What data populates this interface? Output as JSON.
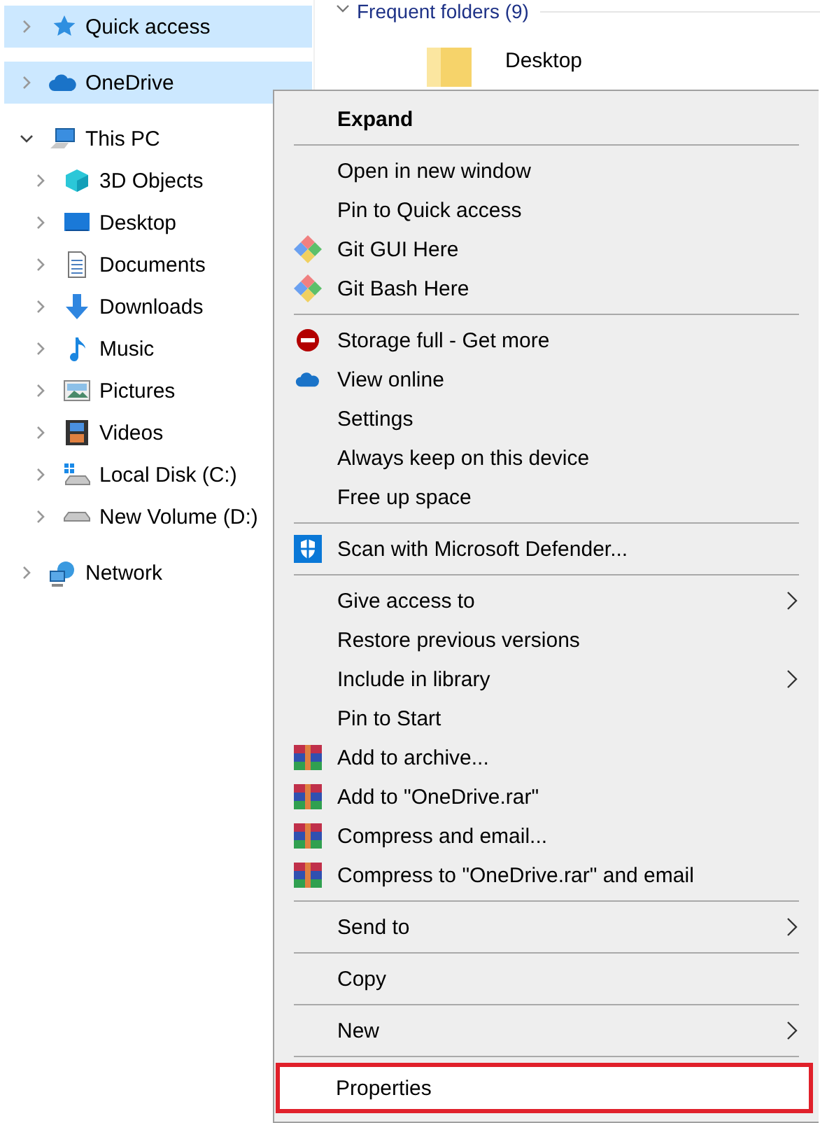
{
  "navigation": [
    {
      "label": "Quick access",
      "selected": true,
      "expanded": false
    },
    {
      "label": "OneDrive",
      "selected": true,
      "expanded": false
    },
    {
      "label": "This PC",
      "selected": false,
      "expanded": true,
      "children": [
        {
          "label": "3D Objects",
          "selected": false,
          "expanded": false
        },
        {
          "label": "Desktop",
          "selected": false,
          "expanded": false
        },
        {
          "label": "Documents",
          "selected": false,
          "expanded": false
        },
        {
          "label": "Downloads",
          "selected": false,
          "expanded": false
        },
        {
          "label": "Music",
          "selected": false,
          "expanded": false
        },
        {
          "label": "Pictures",
          "selected": false,
          "expanded": false
        },
        {
          "label": "Videos",
          "selected": false,
          "expanded": false
        },
        {
          "label": "Local Disk (C:)",
          "selected": false,
          "expanded": false
        },
        {
          "label": "New Volume (D:)",
          "selected": false,
          "expanded": false
        }
      ]
    },
    {
      "label": "Network",
      "selected": false,
      "expanded": false
    }
  ],
  "content": {
    "section_title": "Frequent folders (9)",
    "section_expanded": true,
    "folders": [
      {
        "name": "Desktop"
      }
    ]
  },
  "context_menu": {
    "sections": [
      [
        {
          "label": "Expand",
          "bold": true,
          "submenu": false,
          "highlighted": false
        }
      ],
      [
        {
          "label": "Open in new window",
          "bold": false,
          "submenu": false,
          "highlighted": false
        },
        {
          "label": "Pin to Quick access",
          "bold": false,
          "submenu": false,
          "highlighted": false
        },
        {
          "label": "Git GUI Here",
          "bold": false,
          "submenu": false,
          "highlighted": false
        },
        {
          "label": "Git Bash Here",
          "bold": false,
          "submenu": false,
          "highlighted": false
        }
      ],
      [
        {
          "label": "Storage full - Get more",
          "bold": false,
          "submenu": false,
          "highlighted": false
        },
        {
          "label": "View online",
          "bold": false,
          "submenu": false,
          "highlighted": false
        },
        {
          "label": "Settings",
          "bold": false,
          "submenu": false,
          "highlighted": false
        },
        {
          "label": "Always keep on this device",
          "bold": false,
          "submenu": false,
          "highlighted": false
        },
        {
          "label": "Free up space",
          "bold": false,
          "submenu": false,
          "highlighted": false
        }
      ],
      [
        {
          "label": "Scan with Microsoft Defender...",
          "bold": false,
          "submenu": false,
          "highlighted": false
        }
      ],
      [
        {
          "label": "Give access to",
          "bold": false,
          "submenu": true,
          "highlighted": false
        },
        {
          "label": "Restore previous versions",
          "bold": false,
          "submenu": false,
          "highlighted": false
        },
        {
          "label": "Include in library",
          "bold": false,
          "submenu": true,
          "highlighted": false
        },
        {
          "label": "Pin to Start",
          "bold": false,
          "submenu": false,
          "highlighted": false
        },
        {
          "label": "Add to archive...",
          "bold": false,
          "submenu": false,
          "highlighted": false
        },
        {
          "label": "Add to \"OneDrive.rar\"",
          "bold": false,
          "submenu": false,
          "highlighted": false
        },
        {
          "label": "Compress and email...",
          "bold": false,
          "submenu": false,
          "highlighted": false
        },
        {
          "label": "Compress to \"OneDrive.rar\" and email",
          "bold": false,
          "submenu": false,
          "highlighted": false
        }
      ],
      [
        {
          "label": "Send to",
          "bold": false,
          "submenu": true,
          "highlighted": false
        }
      ],
      [
        {
          "label": "Copy",
          "bold": false,
          "submenu": false,
          "highlighted": false
        }
      ],
      [
        {
          "label": "New",
          "bold": false,
          "submenu": true,
          "highlighted": false
        }
      ],
      [
        {
          "label": "Properties",
          "bold": false,
          "submenu": false,
          "highlighted": true
        }
      ]
    ]
  }
}
